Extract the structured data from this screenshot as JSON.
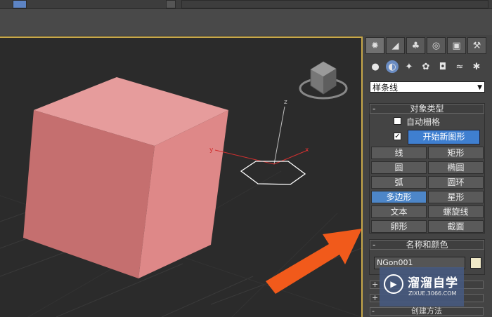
{
  "panel": {
    "tabs": [
      {
        "icon": "create-icon",
        "glyph": "✹"
      },
      {
        "icon": "modify-icon",
        "glyph": "◢"
      },
      {
        "icon": "hierarchy-icon",
        "glyph": "♣"
      },
      {
        "icon": "motion-icon",
        "glyph": "◎"
      },
      {
        "icon": "display-icon",
        "glyph": "▣"
      },
      {
        "icon": "utilities-icon",
        "glyph": "⚒"
      }
    ],
    "category_icons": [
      {
        "icon": "geometry-icon",
        "glyph": "●"
      },
      {
        "icon": "shapes-icon",
        "glyph": "◐"
      },
      {
        "icon": "lights-icon",
        "glyph": "✦"
      },
      {
        "icon": "cameras-icon",
        "glyph": "✿"
      },
      {
        "icon": "helpers-icon",
        "glyph": "◘"
      },
      {
        "icon": "spacewarps-icon",
        "glyph": "≈"
      },
      {
        "icon": "systems-icon",
        "glyph": "✱"
      }
    ],
    "dropdown_value": "样条线",
    "object_type": {
      "title": "对象类型",
      "autogrid_label": "自动栅格",
      "start_new_shape_label": "开始新图形",
      "start_new_shape_checked": "✓",
      "buttons": [
        "线",
        "矩形",
        "圆",
        "椭圆",
        "弧",
        "圆环",
        "多边形",
        "星形",
        "文本",
        "螺旋线",
        "卵形",
        "截面"
      ],
      "active_button": "多边形"
    },
    "name_color": {
      "title": "名称和颜色",
      "name_value": "NGon001",
      "swatch_color": "#f0e9c8"
    },
    "creation_method_title": "创建方法"
  },
  "watermark": {
    "name": "溜溜自学",
    "url": "ZIXUE.3066.COM"
  },
  "viewport": {
    "axis_labels": {
      "z": "z",
      "y": "y",
      "x": "x"
    },
    "box_color": "#d98a8a",
    "arrow_color": "#f15a1b"
  }
}
